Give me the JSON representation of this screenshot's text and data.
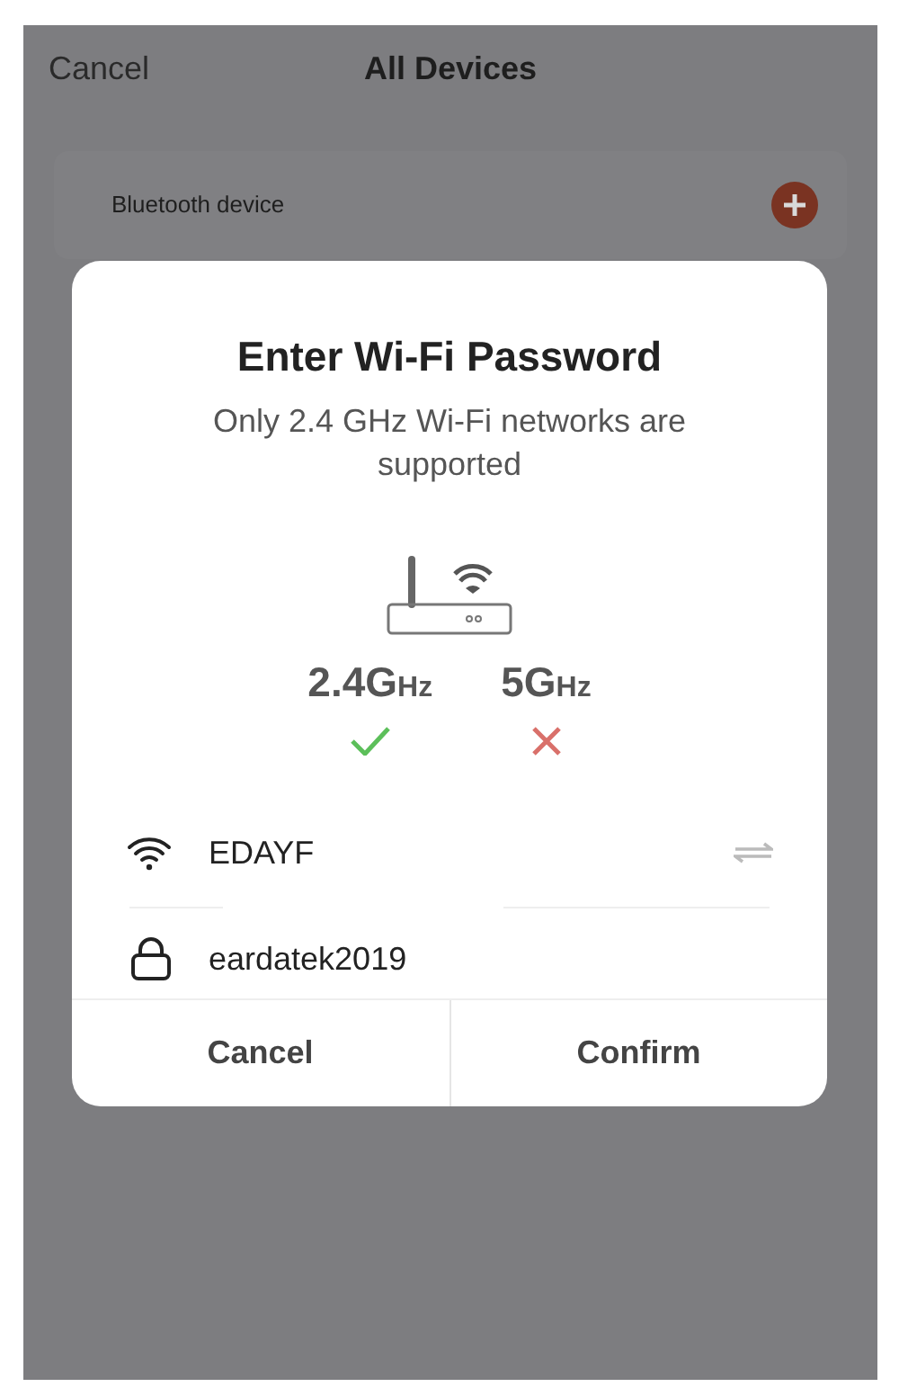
{
  "nav_bar": {
    "cancel": "Cancel",
    "title": "All Devices"
  },
  "device_list": [
    {
      "label": "Bluetooth device"
    }
  ],
  "dialog": {
    "title": "Enter Wi-Fi Password",
    "subtitle": "Only 2.4 GHz Wi-Fi networks are supported",
    "bands": [
      {
        "band": "2.4G",
        "unit": "Hz",
        "supported": true
      },
      {
        "band": "5G",
        "unit": "Hz",
        "supported": false
      }
    ],
    "network": {
      "value": "EDAYF"
    },
    "password": {
      "value": "eardatek2019"
    },
    "buttons": [
      "Cancel",
      "Confirm"
    ]
  }
}
